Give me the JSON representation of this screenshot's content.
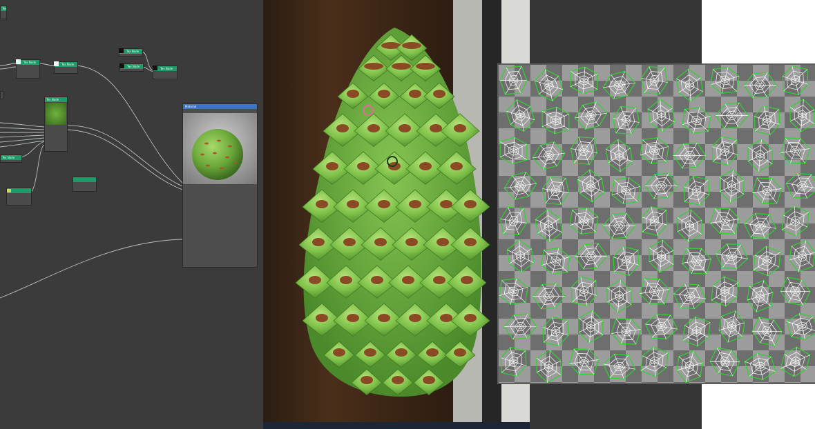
{
  "graph": {
    "nodes": [
      {
        "header": "Tex Node",
        "rows": []
      },
      {
        "header": "Tex Node",
        "rows": []
      },
      {
        "header": "Tex Node",
        "rows": []
      },
      {
        "header": "Tex Node",
        "rows": []
      },
      {
        "header": "Tex Node",
        "rows": []
      },
      {
        "header": "Tex Node",
        "rows": []
      },
      {
        "header": "Tex Node",
        "rows": []
      },
      {
        "header": "Tex Node",
        "rows": []
      }
    ],
    "material_node": {
      "title": "Material",
      "subtitle": "",
      "slots": [
        "",
        "",
        "",
        "",
        "",
        "",
        "",
        "",
        "",
        "",
        "",
        "",
        "",
        "",
        "",
        "",
        "",
        "",
        "",
        "",
        "",
        "",
        "",
        "",
        "",
        "",
        "",
        ""
      ]
    }
  },
  "colors": {
    "node_header": "#1f9a6a",
    "material_header": "#3b74c6",
    "wire": "#cfd8d4",
    "leaf_green": "#7fc24a",
    "spike_brown": "#8a4a24",
    "uv_outline": "#2fd22f",
    "uv_wire": "#ffffff"
  }
}
